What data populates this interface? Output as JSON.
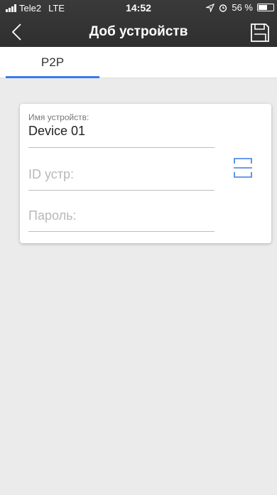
{
  "status": {
    "carrier": "Tele2",
    "network": "LTE",
    "time": "14:52",
    "battery": "56 %",
    "icons": [
      "signal-icon",
      "location-icon",
      "alarm-icon",
      "battery-icon"
    ]
  },
  "nav": {
    "title": "Доб устройств",
    "back_icon": "chevron-left-icon",
    "save_icon": "save-icon"
  },
  "tabs": [
    {
      "label": "P2P",
      "active": true
    }
  ],
  "form": {
    "name_label": "Имя устройств:",
    "name_value": "Device 01",
    "id_placeholder": "ID устр:",
    "password_placeholder": "Пароль:",
    "scan_icon": "scan-qr-icon"
  },
  "colors": {
    "header": "#2b2b2b",
    "accent": "#3a7de6",
    "background": "#ebebeb"
  }
}
